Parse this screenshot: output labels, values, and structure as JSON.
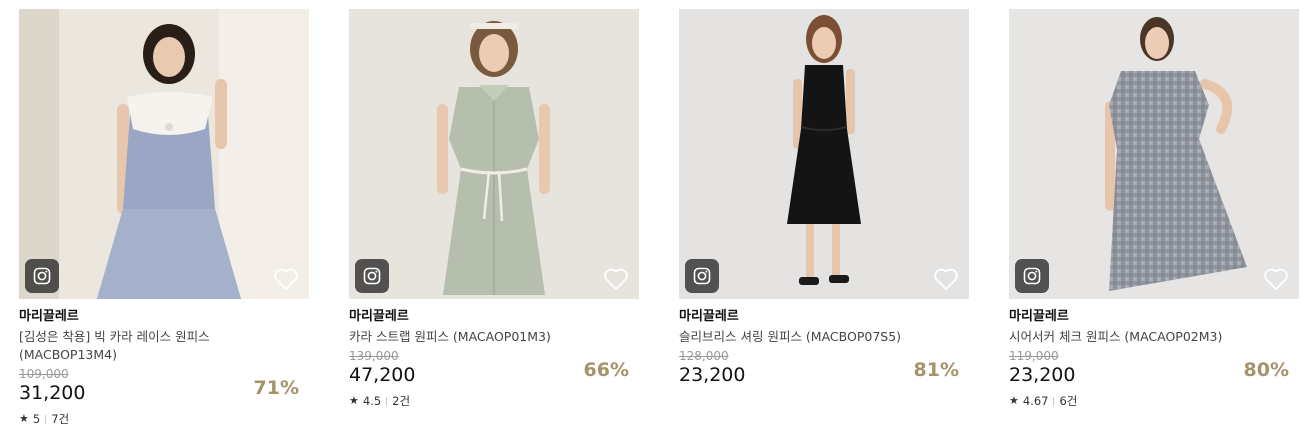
{
  "products": [
    {
      "brand": "마리끌레르",
      "name": "[김성은 착용] 빅 카라 레이스 원피스 (MACBOP13M4)",
      "name_line1": "[김성은 착용] 빅 카라 레이스 원피스",
      "name_line2": "(MACBOP13M4)",
      "original_price": "109,000",
      "price": "31,200",
      "discount": "71%",
      "rating": "5",
      "reviews": "7건",
      "photo_bg": "#e8e2d8",
      "dress_color": "#9aa6c4",
      "icons": [
        "instagram-icon",
        "heart-icon"
      ]
    },
    {
      "brand": "마리끌레르",
      "name": "카라 스트랩 원피스 (MACAOP01M3)",
      "original_price": "139,000",
      "price": "47,200",
      "discount": "66%",
      "rating": "4.5",
      "reviews": "2건",
      "photo_bg": "#e6e2dc",
      "dress_color": "#b6bfae",
      "icons": [
        "instagram-icon",
        "heart-icon"
      ]
    },
    {
      "brand": "마리끌레르",
      "name": "슬리브리스 셔링 원피스 (MACBOP07S5)",
      "original_price": "128,000",
      "price": "23,200",
      "discount": "81%",
      "photo_bg": "#e4e3e1",
      "dress_color": "#141414",
      "icons": [
        "instagram-icon",
        "heart-icon"
      ]
    },
    {
      "brand": "마리끌레르",
      "name": "시어서커 체크 원피스 (MACAOP02M3)",
      "original_price": "119,000",
      "price": "23,200",
      "discount": "80%",
      "rating": "4.67",
      "reviews": "6건",
      "photo_bg": "#e6e5e3",
      "dress_color": "#8a8f9a",
      "icons": [
        "instagram-icon",
        "heart-icon"
      ]
    }
  ],
  "colors": {
    "discount": "#a5946b",
    "original_price": "#9a9a9a",
    "brand": "#111111"
  }
}
